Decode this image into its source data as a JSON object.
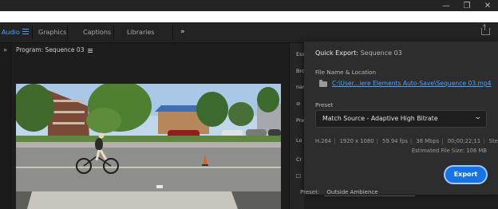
{
  "window": {
    "minimize": "—",
    "maximize": "❐",
    "close": "✕"
  },
  "workspace_tabs": {
    "active": "Audio",
    "tabs": [
      "Graphics",
      "Captions",
      "Libraries"
    ],
    "overflow": "»"
  },
  "left_panel": {
    "expand": "»"
  },
  "program_monitor": {
    "title": "Program: Sequence 03"
  },
  "side_panel_fragments": [
    "Ess",
    "Bro",
    "nar",
    "Pre",
    "Lo",
    "Cr"
  ],
  "quick_export": {
    "title": "Quick Export:",
    "sequence": "Sequence 03",
    "file_label": "File Name & Location",
    "path": "C:\\User...iere Elements Auto-Save\\Sequence 03.mp4",
    "preset_label": "Preset",
    "preset_value": "Match Source - Adaptive High Bitrate",
    "specs": [
      "H.264",
      "1920 x 1080",
      "59.94 fps",
      "38 Mbps",
      "00;00;22;11",
      "Stereo"
    ],
    "file_size": "Estimated File Size: 106 MB",
    "export_label": "Export"
  },
  "bottom_row": {
    "label": "Preset:",
    "value": "Outside Ambience"
  },
  "colors": {
    "accent": "#4aa3ff",
    "export": "#1473e6"
  }
}
